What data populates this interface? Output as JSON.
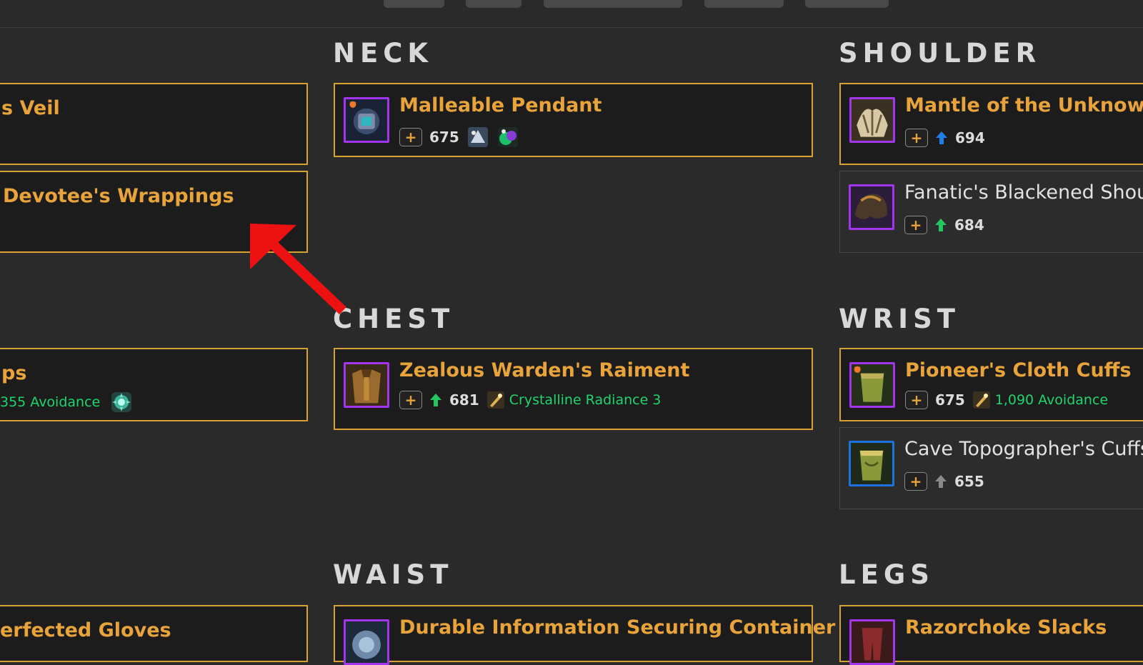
{
  "colors": {
    "accent_gold": "#e8a33a",
    "upgrade_green": "#22c55e",
    "upgrade_blue": "#1e7fe6",
    "stat_green": "#1fd56d",
    "epic_purple": "#a335ee",
    "rare_blue": "#1a73e0"
  },
  "sections": {
    "neck": {
      "title": "NECK"
    },
    "shoulder": {
      "title": "SHOULDER"
    },
    "chest": {
      "title": "CHEST"
    },
    "wrist": {
      "title": "WRIST"
    },
    "waist": {
      "title": "WAIST"
    },
    "legs": {
      "title": "LEGS"
    }
  },
  "left_column": {
    "veil": {
      "name": "s Veil"
    },
    "devotee": {
      "name": "Devotee's Wrappings"
    },
    "straps": {
      "name": "ps",
      "stat": "355 Avoidance",
      "gem_icon": "gem-icon"
    },
    "gloves": {
      "name": "erfected Gloves"
    }
  },
  "neck": {
    "items": [
      {
        "name": "Malleable Pendant",
        "plus": "+",
        "ilvl": "675"
      }
    ]
  },
  "chest": {
    "items": [
      {
        "name": "Zealous Warden's Raiment",
        "plus": "+",
        "ilvl": "681",
        "upgrade": "green",
        "enchant": "Crystalline Radiance 3"
      }
    ]
  },
  "waist": {
    "items": [
      {
        "name": "Durable Information Securing Container"
      }
    ]
  },
  "shoulder": {
    "items": [
      {
        "name": "Mantle of the Unknowing",
        "plus": "+",
        "ilvl": "694",
        "upgrade": "blue"
      },
      {
        "name": "Fanatic's Blackened Shoul",
        "plus": "+",
        "ilvl": "684",
        "upgrade": "green"
      }
    ]
  },
  "wrist": {
    "items": [
      {
        "name": "Pioneer's Cloth Cuffs",
        "plus": "+",
        "ilvl": "675",
        "stat": "1,090 Avoidance"
      },
      {
        "name": "Cave Topographer's Cuffs",
        "plus": "+",
        "ilvl": "655",
        "upgrade": "gray"
      }
    ]
  },
  "legs": {
    "items": [
      {
        "name": "Razorchoke Slacks"
      }
    ]
  }
}
